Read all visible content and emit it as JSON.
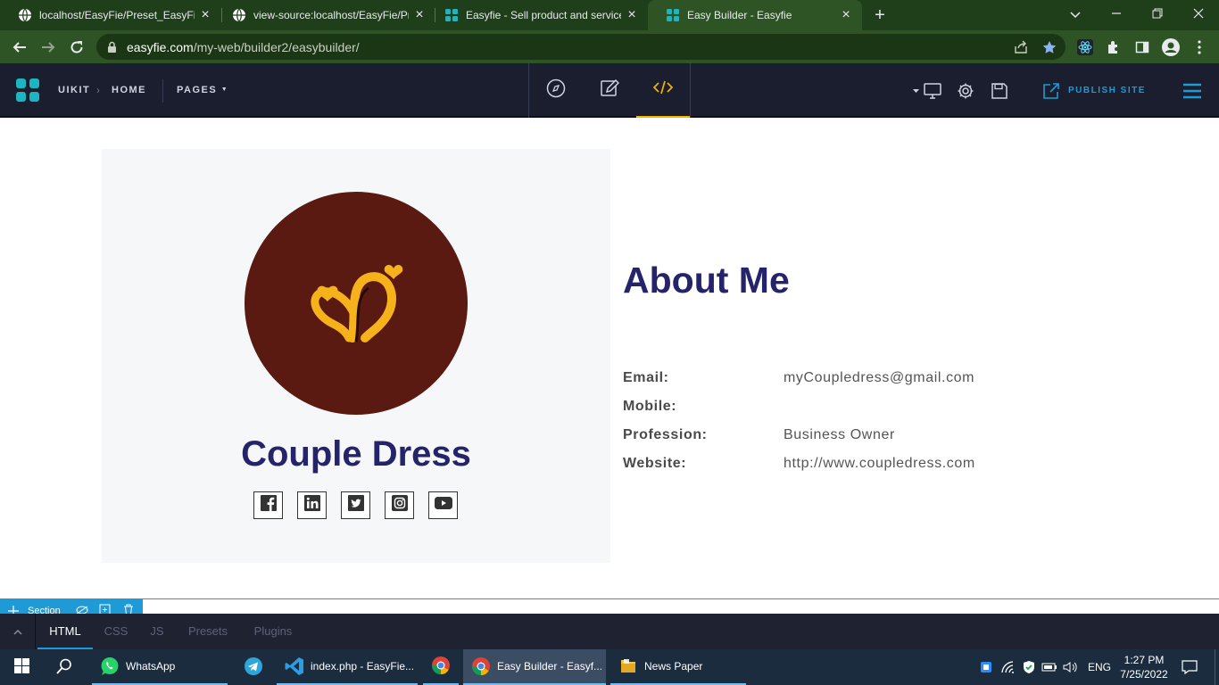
{
  "browser": {
    "tabs": [
      {
        "title": "localhost/EasyFie/Preset_EasyFie/",
        "active": false
      },
      {
        "title": "view-source:localhost/EasyFie/Pr",
        "active": false
      },
      {
        "title": "Easyfie - Sell product and service",
        "active": false
      },
      {
        "title": "Easy Builder - Easyfie",
        "active": true
      }
    ],
    "new_tab_symbol": "+",
    "close_symbol": "×",
    "url_host": "easyfie.com",
    "url_path": "/my-web/builder2/easybuilder/"
  },
  "builder": {
    "breadcrumb": [
      "UIKIT",
      "HOME"
    ],
    "breadcrumb_separator": "›",
    "pages_label": "PAGES",
    "publish_label": "PUBLISH SITE",
    "accent_color": "#1e9ad6",
    "active_mode_color": "#f5b301"
  },
  "content": {
    "card_name": "Couple Dress",
    "about_title": "About Me",
    "info": [
      {
        "label": "Email:",
        "value": "myCoupledress@gmail.com"
      },
      {
        "label": "Mobile:",
        "value": ""
      },
      {
        "label": "Profession:",
        "value": "Business Owner"
      },
      {
        "label": "Website:",
        "value": "http://www.coupledress.com"
      }
    ],
    "socials": [
      "facebook-icon",
      "linkedin-icon",
      "twitter-icon",
      "instagram-icon",
      "youtube-icon"
    ],
    "heading_color": "#25246b",
    "avatar_color": "#5a1a12"
  },
  "section_tag": {
    "label": "Section"
  },
  "editor": {
    "tabs": [
      "HTML",
      "CSS",
      "JS",
      "Presets",
      "Plugins"
    ],
    "active_tab": "HTML"
  },
  "taskbar": {
    "apps": [
      {
        "label": "WhatsApp",
        "icon": "whatsapp-icon"
      },
      {
        "label": "",
        "icon": "telegram-icon"
      },
      {
        "label": "index.php - EasyFie...",
        "icon": "vscode-icon"
      },
      {
        "label": "",
        "icon": "chrome-icon"
      },
      {
        "label": "Easy Builder - Easyf...",
        "icon": "chrome-icon"
      },
      {
        "label": "News Paper",
        "icon": "folder-icon"
      }
    ],
    "language": "ENG",
    "time": "1:27 PM",
    "date": "7/25/2022"
  }
}
